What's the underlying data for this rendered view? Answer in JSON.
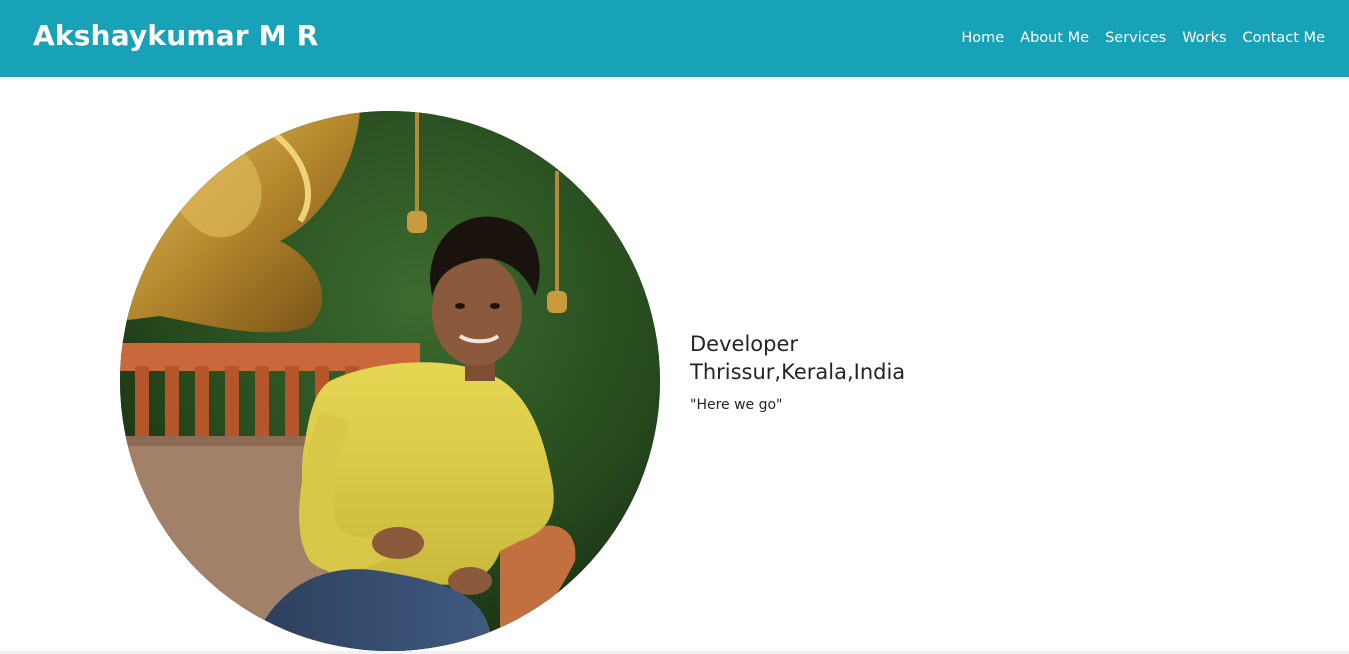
{
  "navbar": {
    "brand": "Akshaykumar M R",
    "links": [
      "Home",
      "About Me",
      "Services",
      "Works",
      "Contact Me"
    ],
    "background_color": "#17a2b8"
  },
  "hero": {
    "role": "Developer",
    "location": "Thrissur,Kerala,India",
    "quote": "\"Here we go\""
  }
}
